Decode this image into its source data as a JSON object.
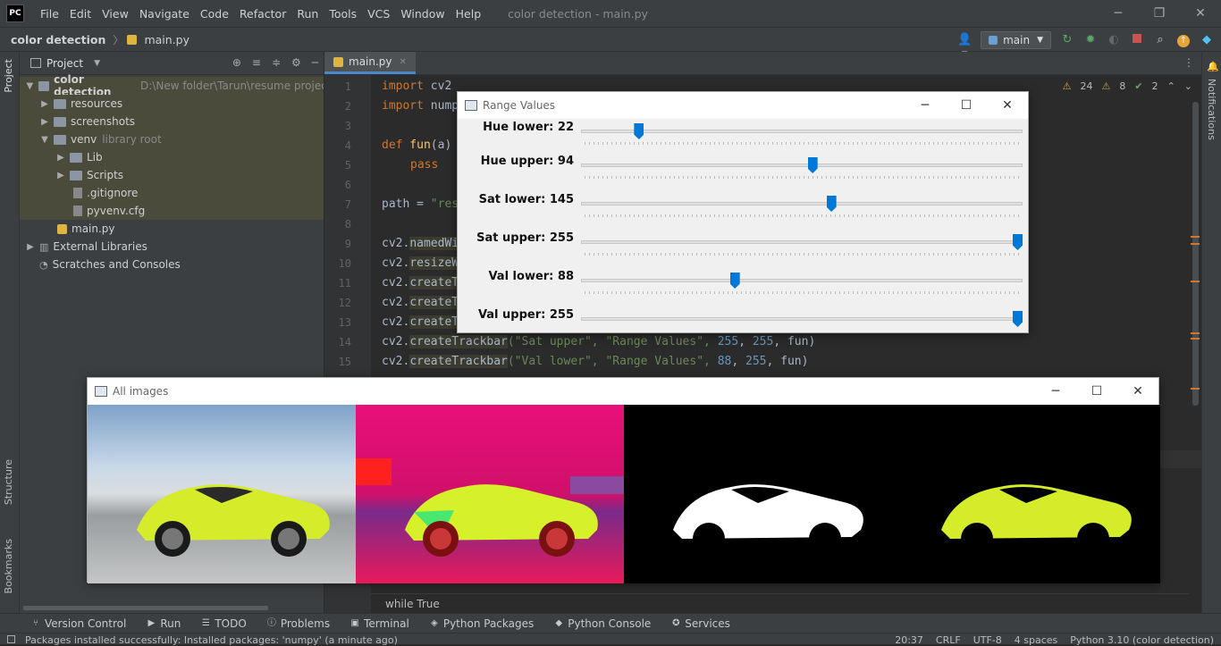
{
  "titlebar": {
    "logo": "PC",
    "menu": [
      "File",
      "Edit",
      "View",
      "Navigate",
      "Code",
      "Refactor",
      "Run",
      "Tools",
      "VCS",
      "Window",
      "Help"
    ],
    "window_title": "color detection - main.py"
  },
  "navbar": {
    "project": "color detection",
    "file": "main.py",
    "run_config": "main"
  },
  "project_panel": {
    "title": "Project",
    "tree": [
      {
        "label": "color detection",
        "extra": "D:\\New folder\\Tarun\\resume projects\\c",
        "type": "folder",
        "expanded": true
      },
      {
        "label": "resources",
        "type": "folder"
      },
      {
        "label": "screenshots",
        "type": "folder"
      },
      {
        "label": "venv",
        "extra": "library root",
        "type": "folder",
        "expanded": true
      },
      {
        "label": "Lib",
        "type": "folder"
      },
      {
        "label": "Scripts",
        "type": "folder"
      },
      {
        "label": ".gitignore",
        "type": "file"
      },
      {
        "label": "pyvenv.cfg",
        "type": "file"
      },
      {
        "label": "main.py",
        "type": "file"
      },
      {
        "label": "External Libraries",
        "type": "lib"
      },
      {
        "label": "Scratches and Consoles",
        "type": "scratch"
      }
    ]
  },
  "editor": {
    "tab": "main.py",
    "inspections": {
      "warnings": "24",
      "weak": "8",
      "typos": "2"
    },
    "lines": [
      "1",
      "2",
      "3",
      "4",
      "5",
      "6",
      "7",
      "8",
      "9",
      "10",
      "11",
      "12",
      "13",
      "14",
      "15"
    ],
    "code": {
      "l1a": "import",
      "l1b": " cv2",
      "l2a": "import",
      "l2b": " nump",
      "l4a": "def",
      "l4b": " fun",
      "l4c": "(a)",
      "l5": "pass",
      "l7a": "path = ",
      "l7b": "\"res",
      "l9a": "cv2.",
      "l9b": "namedWi",
      "l10a": "cv2.",
      "l10b": "resizeW",
      "l11a": "cv2.",
      "l11b": "createT",
      "l12a": "cv2.",
      "l12b": "createT",
      "l13a": "cv2.",
      "l13b": "createT",
      "l14a": "cv2.",
      "l14b": "createTrackbar",
      "l14c": "(\"Sat upper\", \"Range Values\", ",
      "l14d": "255",
      ", ": ", ",
      "l14e": "255",
      "l14f": ", fun)",
      "l15a": "cv2.",
      "l15b": "createTrackbar",
      "l15c": "(\"Val lower\", \"Range Values\", ",
      "l15d": "88",
      "l15e": "255",
      "l15f": ", fun)"
    },
    "breadcrumb_bottom": "while True"
  },
  "range_window": {
    "title": "Range Values",
    "trackbars": [
      {
        "label": "Hue lower: 22",
        "value": 22,
        "max": 179
      },
      {
        "label": "Hue upper: 94",
        "value": 94,
        "max": 179
      },
      {
        "label": "Sat lower: 145",
        "value": 145,
        "max": 255
      },
      {
        "label": "Sat upper: 255",
        "value": 255,
        "max": 255
      },
      {
        "label": "Val lower: 88",
        "value": 88,
        "max": 255
      },
      {
        "label": "Val upper: 255",
        "value": 255,
        "max": 255
      }
    ]
  },
  "images_window": {
    "title": "All images"
  },
  "side_tabs": {
    "project": "Project",
    "structure": "Structure",
    "bookmarks": "Bookmarks",
    "notifications": "Notifications"
  },
  "bottom_tools": [
    "Version Control",
    "Run",
    "TODO",
    "Problems",
    "Terminal",
    "Python Packages",
    "Python Console",
    "Services"
  ],
  "status": {
    "message": "Packages installed successfully: Installed packages: 'numpy' (a minute ago)",
    "position": "20:37",
    "line_sep": "CRLF",
    "encoding": "UTF-8",
    "indent": "4 spaces",
    "interpreter": "Python 3.10 (color detection)"
  }
}
